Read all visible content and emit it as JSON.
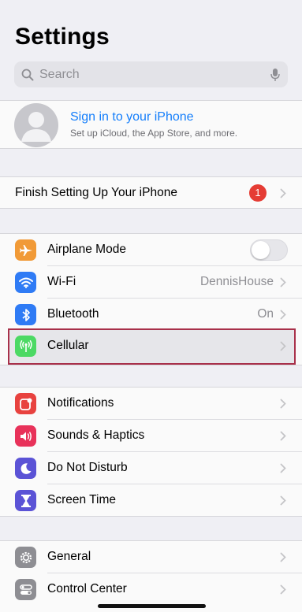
{
  "header": {
    "title": "Settings"
  },
  "search": {
    "placeholder": "Search"
  },
  "profile": {
    "title": "Sign in to your iPhone",
    "subtitle": "Set up iCloud, the App Store, and more."
  },
  "finish_setup": {
    "label": "Finish Setting Up Your iPhone",
    "badge": "1"
  },
  "connectivity": {
    "airplane": {
      "label": "Airplane Mode",
      "toggle_on": false
    },
    "wifi": {
      "label": "Wi-Fi",
      "value": "DennisHouse"
    },
    "bluetooth": {
      "label": "Bluetooth",
      "value": "On"
    },
    "cellular": {
      "label": "Cellular"
    }
  },
  "alerts": {
    "notifications": {
      "label": "Notifications"
    },
    "sounds": {
      "label": "Sounds & Haptics"
    },
    "dnd": {
      "label": "Do Not Disturb"
    },
    "screen_time": {
      "label": "Screen Time"
    }
  },
  "system": {
    "general": {
      "label": "General"
    },
    "control_center": {
      "label": "Control Center"
    }
  },
  "colors": {
    "airplane": "#f19a37",
    "wifi": "#2f7bf5",
    "bluetooth": "#2f7bf5",
    "cellular": "#4cd964",
    "notifications": "#e8423f",
    "sounds": "#e8325a",
    "dnd": "#5b53d6",
    "screen_time": "#5b53d6",
    "general": "#8e8e93",
    "control_center": "#8e8e93",
    "link": "#147efb",
    "badge": "#e53c34"
  }
}
